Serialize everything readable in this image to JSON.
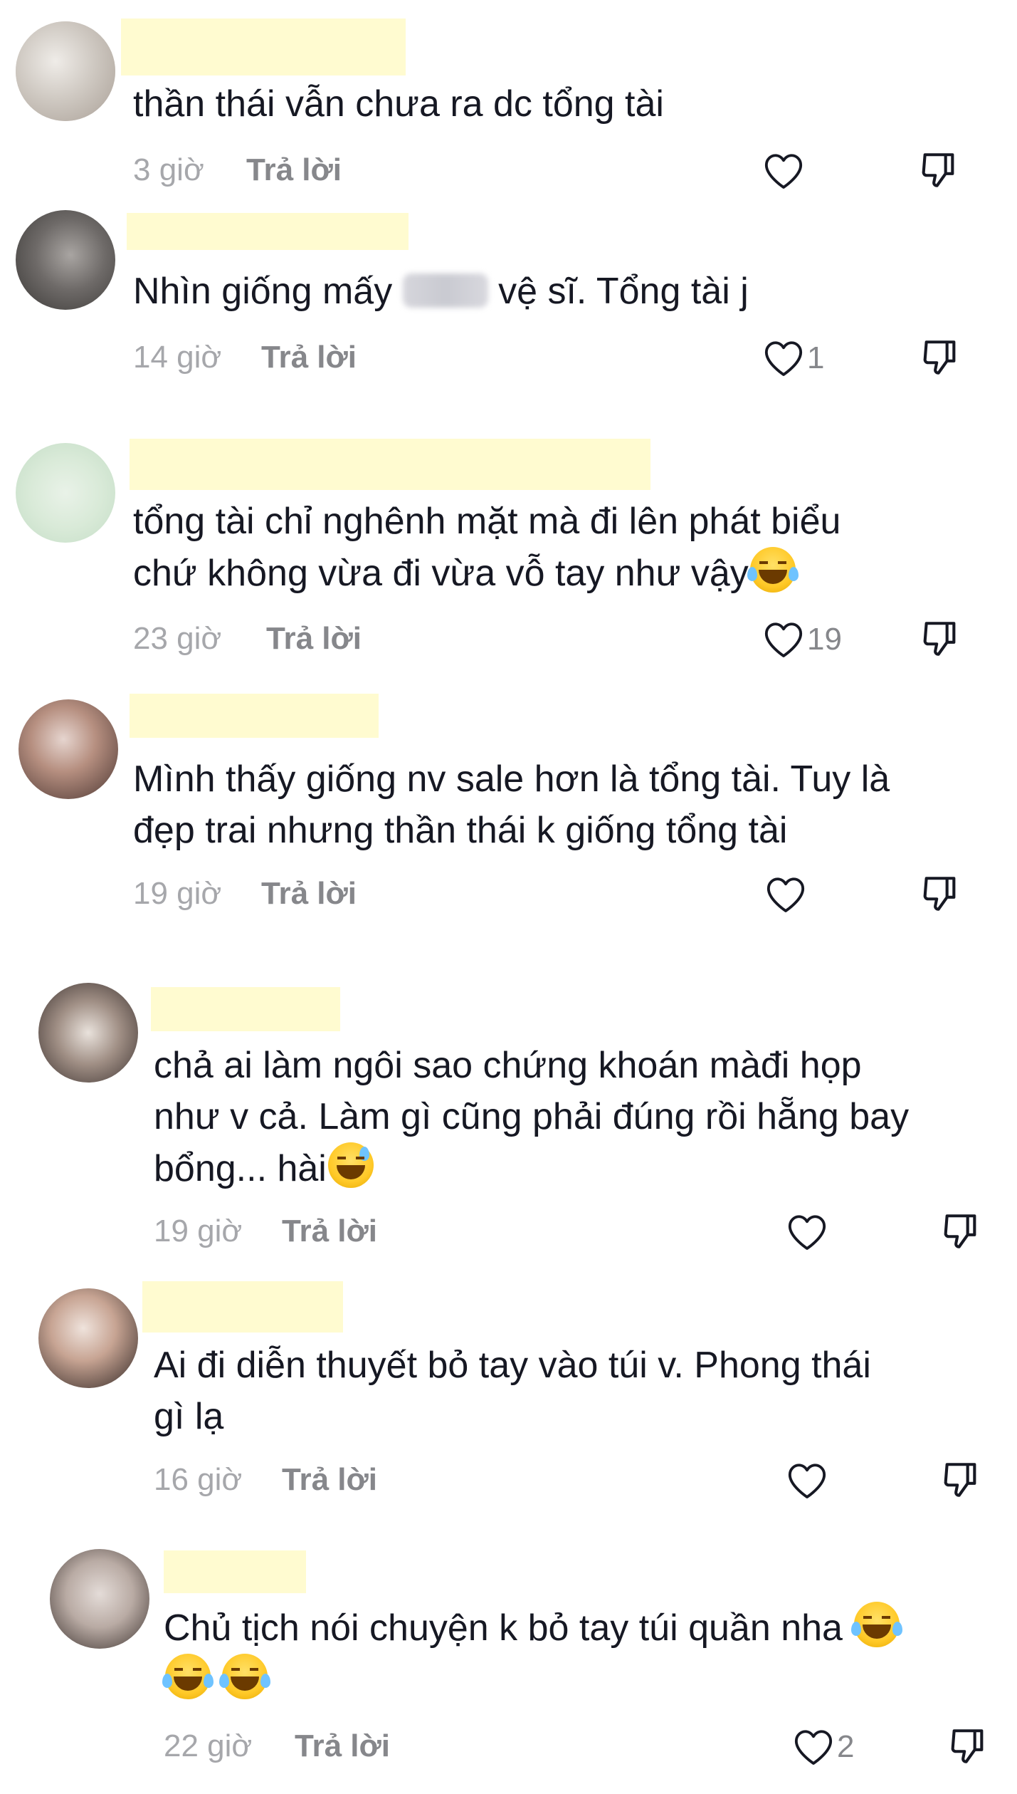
{
  "comments": [
    {
      "text": "thần thái vẫn chưa ra dc tổng tài",
      "time": "3 giờ",
      "reply": "Trả lời",
      "likes": "",
      "avatar_colors": [
        "#cfc9c2",
        "#a99f96",
        "#efece8"
      ]
    },
    {
      "text_before": "Nhìn giống mấy ",
      "text_after": " vệ sĩ. Tổng tài j",
      "time": "14 giờ",
      "reply": "Trả lời",
      "likes": "1",
      "avatar_colors": [
        "#6e6a68",
        "#3a3836",
        "#a9a5a2"
      ]
    },
    {
      "text": "tổng tài chỉ nghênh mặt mà đi lên phát biểu\nchứ không vừa đi vừa vỗ tay như vậy",
      "time": "23 giờ",
      "reply": "Trả lời",
      "likes": "19",
      "avatar_colors": [
        "#d9ead8",
        "#c4ddc6",
        "#e9f2e8"
      ]
    },
    {
      "text": "Mình thấy giống nv sale hơn là tổng tài. Tuy là\nđẹp trai nhưng thần thái k giống tổng tài",
      "time": "19 giờ",
      "reply": "Trả lời",
      "likes": "",
      "avatar_colors": [
        "#b68f80",
        "#4a3531",
        "#e6d5cf"
      ]
    },
    {
      "text": "chả ai làm ngôi sao chứng khoán màđi họp\nnhư v cả. Làm gì cũng phải đúng rồi hẵng bay\nbổng... hài",
      "time": "19 giờ",
      "reply": "Trả lời",
      "likes": "",
      "avatar_colors": [
        "#a08f85",
        "#3c3230",
        "#e9e2dc"
      ]
    },
    {
      "text": "Ai đi diễn thuyết bỏ tay vào túi v. Phong thái\ngì lạ",
      "time": "16 giờ",
      "reply": "Trả lời",
      "likes": "",
      "avatar_colors": [
        "#c7a493",
        "#2e2422",
        "#efe3dc"
      ]
    },
    {
      "text": "Chủ tịch nói chuyện k bỏ tay túi quần nha ",
      "time": "22 giờ",
      "reply": "Trả lời",
      "likes": "2",
      "avatar_colors": [
        "#b9aba4",
        "#3a302d",
        "#e4dcd8"
      ]
    }
  ],
  "colors": {
    "text": "#161823",
    "meta": "#a6a7ab",
    "reply": "#86878b",
    "name_mask": "#fffbd0"
  },
  "icons": [
    "heart-icon",
    "dislike-icon",
    "laughing-tears-emoji",
    "sweat-smile-emoji"
  ]
}
